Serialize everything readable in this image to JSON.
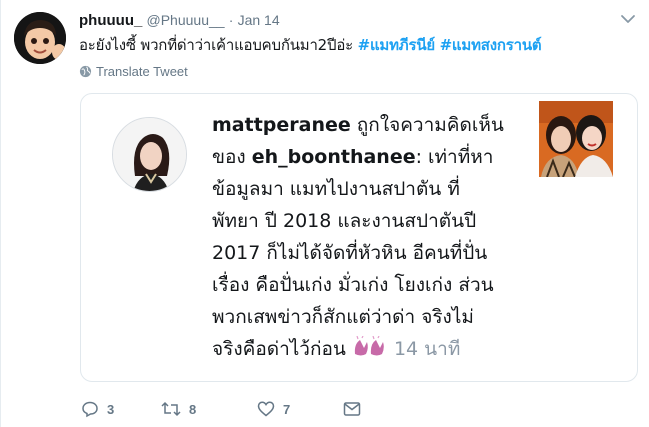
{
  "tweet": {
    "display_name": "phuuuu_",
    "handle": "@Phuuuu__",
    "separator": "·",
    "date": "Jan 14",
    "text": "อะยังไงซี้ พวกที่ด่าว่าเค้าแอบคบกันมา2ปีอ่ะ ",
    "hashtags": [
      "#แมทภีรนีย์",
      "#แมทสงกรานต์"
    ],
    "translate_label": "Translate Tweet"
  },
  "card": {
    "author": "mattperanee",
    "line1_rest": " ถูกใจความคิดเห็น",
    "line2_prefix": "ของ ",
    "mention": "eh_boonthanee",
    "line2_rest": ": เท่าที่หา",
    "line3": "ข้อมูลมา แมทไปงานสปาตัน ที่",
    "line4": "พัทยา ปี 2018 และงานสปาตันปี",
    "line5": "2017 ก็ไม่ได้จัดที่หัวหิน อีคนที่ปั่น",
    "line6": "เรื่อง คือปั่นเก่ง มั่วเก่ง โยงเก่ง ส่วน",
    "line7": "พวกเสพข่าวก็สักแต่ว่าด่า จริงไม่",
    "line8": "จริงคือด่าไว้ก่อน ",
    "time_ago": "14 นาที"
  },
  "actions": {
    "reply_count": "3",
    "retweet_count": "8",
    "like_count": "7"
  },
  "icons": [
    "avatar-memoji",
    "chevron-down-icon",
    "globe-icon",
    "clap-emoji",
    "reply-icon",
    "retweet-icon",
    "heart-icon",
    "message-icon"
  ],
  "colors": {
    "accent": "#1da1f2",
    "muted": "#657786",
    "border": "#e1e8ed"
  }
}
